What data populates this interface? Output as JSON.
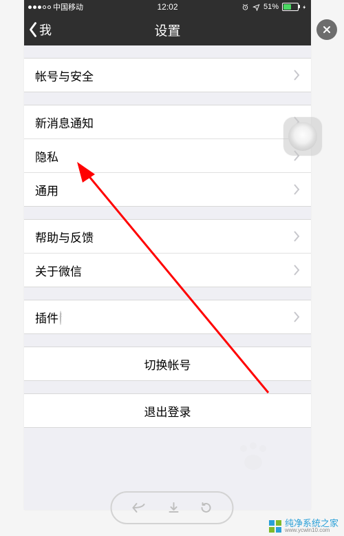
{
  "statusbar": {
    "carrier": "中国移动",
    "time": "12:02",
    "battery_pct": "51%"
  },
  "navbar": {
    "back": "我",
    "title": "设置"
  },
  "groups": [
    {
      "items": [
        {
          "label": "帐号与安全"
        }
      ]
    },
    {
      "items": [
        {
          "label": "新消息通知"
        },
        {
          "label": "隐私"
        },
        {
          "label": "通用"
        }
      ]
    },
    {
      "items": [
        {
          "label": "帮助与反馈"
        },
        {
          "label": "关于微信"
        }
      ]
    },
    {
      "items": [
        {
          "label": "插件",
          "bulb": true
        }
      ]
    }
  ],
  "actions": {
    "switch": "切换帐号",
    "logout": "退出登录"
  },
  "watermark": {
    "brand": "纯净系统之家",
    "url": "www.ycwin10.com"
  }
}
